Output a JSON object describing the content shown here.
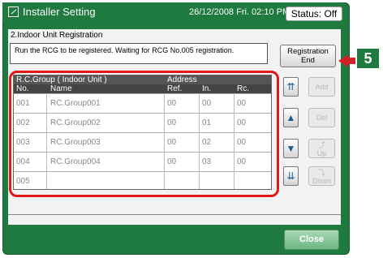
{
  "titlebar": {
    "title": "Installer Setting",
    "datetime": "26/12/2008 Fri. 02:10 PM",
    "status": "Status: Off"
  },
  "subtitle": "2.Indoor Unit Registration",
  "message": "Run the RCG to be registered. Waiting for RCG No.005 registration.",
  "registration_end": {
    "line1": "Registration",
    "line2": "End"
  },
  "callout": "5",
  "table": {
    "group_header": "R.C.Group ( Indoor Unit )",
    "address_header": "Address",
    "columns": {
      "no": "No.",
      "name": "Name",
      "ref": "Ref.",
      "in": "In.",
      "rc": "Rc."
    },
    "rows": [
      {
        "no": "001",
        "name": "RC.Group001",
        "ref": "00",
        "in": "00",
        "rc": "00"
      },
      {
        "no": "002",
        "name": "RC.Group002",
        "ref": "00",
        "in": "01",
        "rc": "00"
      },
      {
        "no": "003",
        "name": "RC.Group003",
        "ref": "00",
        "in": "02",
        "rc": "00"
      },
      {
        "no": "004",
        "name": "RC.Group004",
        "ref": "00",
        "in": "03",
        "rc": "00"
      },
      {
        "no": "005",
        "name": "",
        "ref": "",
        "in": "",
        "rc": ""
      }
    ]
  },
  "buttons": {
    "add": "Add",
    "del": "Del",
    "up": "Up",
    "down": "Down",
    "close": "Close"
  },
  "icons": {
    "scroll_top": "double-up-arrow",
    "scroll_up": "up-arrow",
    "scroll_down": "down-arrow",
    "scroll_bottom": "double-down-arrow"
  },
  "colors": {
    "frame": "#1e7a3e",
    "highlight": "#e01818",
    "header": "#555555"
  }
}
